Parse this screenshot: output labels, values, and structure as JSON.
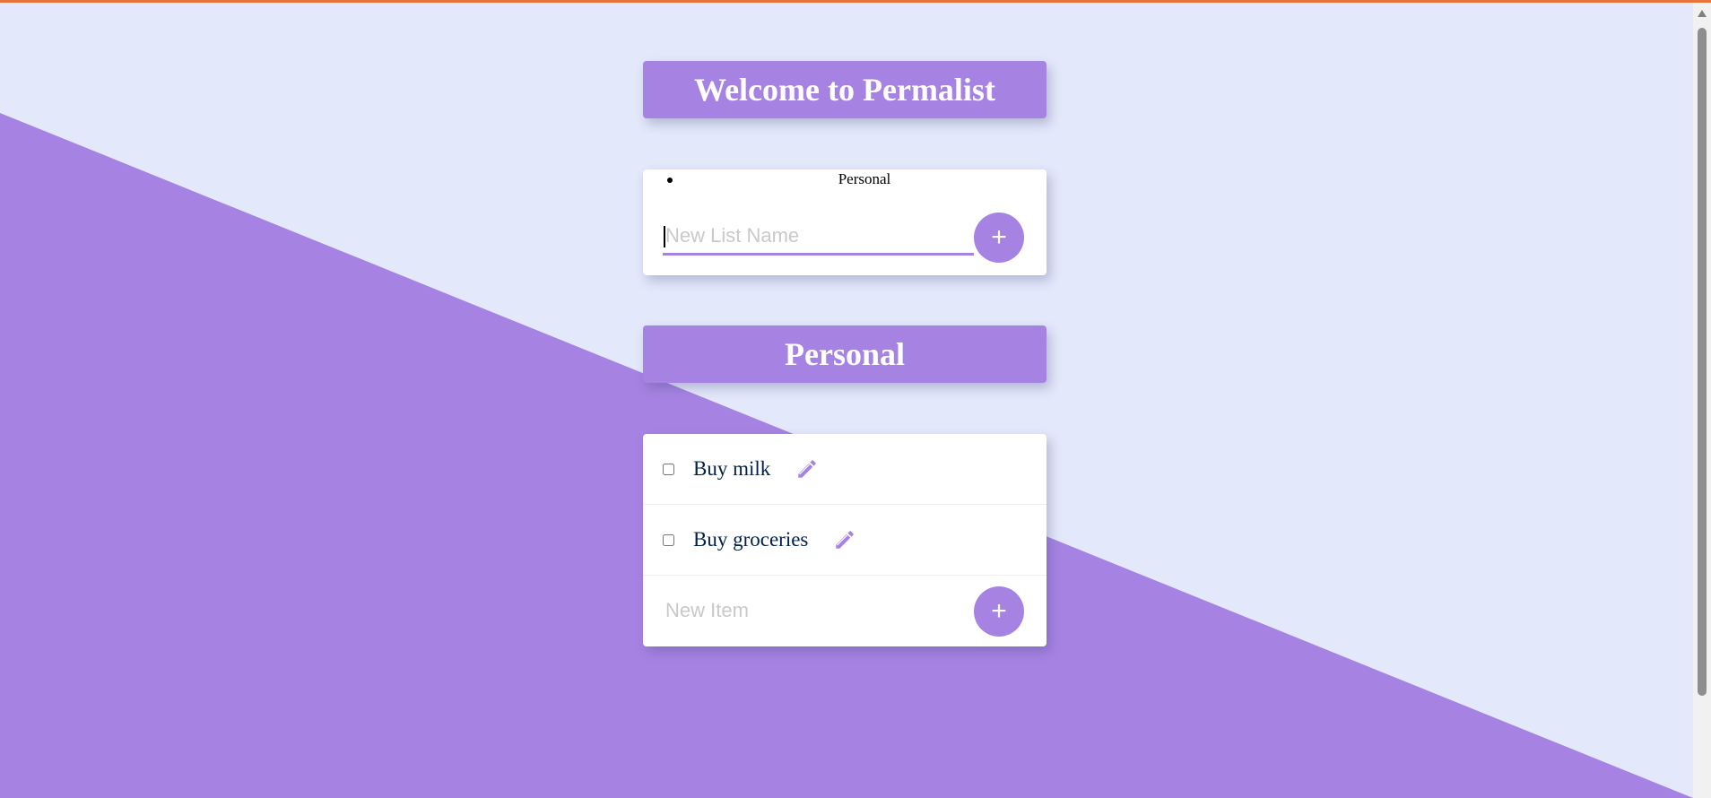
{
  "page": {
    "background_color": "#E3E8FB",
    "accent_color": "#A683E3",
    "top_bar_color": "#E8743B"
  },
  "header": {
    "title": "Welcome to Permalist"
  },
  "lists": {
    "items": [
      {
        "label": "Personal"
      }
    ],
    "new_list_placeholder": "New List Name",
    "add_button_label": "+"
  },
  "current_list": {
    "title": "Personal",
    "items": [
      {
        "text": "Buy milk",
        "checked": false,
        "edit_icon": "pencil-icon"
      },
      {
        "text": "Buy groceries",
        "checked": false,
        "edit_icon": "pencil-icon"
      }
    ],
    "new_item_placeholder": "New Item",
    "add_button_label": "+"
  }
}
